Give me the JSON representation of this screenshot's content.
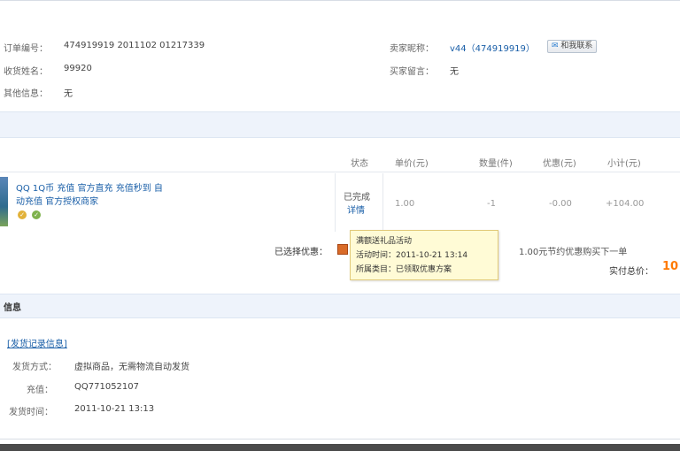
{
  "order_info": {
    "order_no_label": "订单编号：",
    "order_no_value": "474919919 2011102 01217339",
    "seller_label": "卖家昵称：",
    "seller_value": "v44（474919919）",
    "contact_button": "和我联系",
    "receiver_label": "收货姓名：",
    "receiver_value": "99920",
    "buyer_note_label": "买家留言：",
    "buyer_note_value": "无",
    "other_label": "其他信息：",
    "other_value": "无"
  },
  "goods_table": {
    "headers": [
      "状态",
      "单价(元)",
      "数量(件)",
      "优惠(元)",
      "小计(元)"
    ],
    "item": {
      "title_line1": "QQ 1Q币 充值 官方直充 充值秒到 自",
      "title_line2": "动充值 官方授权商家",
      "status_line1": "已完成",
      "status_line2": "详情",
      "unit_price": "1.00",
      "quantity": "-1",
      "discount": "-0.00",
      "subtotal": "+104.00"
    },
    "promo_label": "已选择优惠：",
    "promo_text": "1.00元节约优惠购买下一单",
    "total_label": "实付总价：",
    "total_value": "10"
  },
  "tooltip": {
    "line1": "满额送礼品活动",
    "line2": "活动时间：2011-10-21 13:14",
    "line3": "所属类目：已领取优惠方案"
  },
  "section_title": "信息",
  "delivery": {
    "link_label": "[发货记录信息]",
    "method_label": "发货方式：",
    "method_value": "虚拟商品，无需物流自动发货",
    "account_label": "充值：",
    "account_value": "QQ771052107",
    "time_label": "发货时间：",
    "time_value": "2011-10-21 13:13"
  },
  "colors": {
    "band": "#eef3fb",
    "link": "#1a5fa8",
    "total": "#ff7a00",
    "tooltip_bg": "#fffbd6"
  }
}
